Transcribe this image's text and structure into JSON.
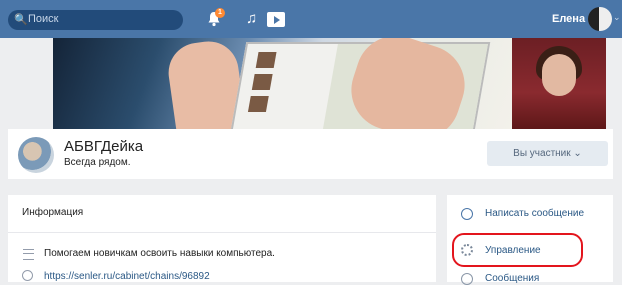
{
  "topbar": {
    "search_placeholder": "Поиск",
    "notifications_count": "1",
    "user_name": "Елена"
  },
  "group": {
    "name": "АБВГДейка",
    "status": "Всегда рядом.",
    "member_button": "Вы участник ⌄"
  },
  "info": {
    "title": "Информация",
    "description": "Помогаем новичкам освоить навыки компьютера.",
    "link": "https://senler.ru/cabinet/chains/96892"
  },
  "sidebar": {
    "items": [
      {
        "label": "Написать сообщение"
      },
      {
        "label": "Управление"
      },
      {
        "label": "Сообщения"
      }
    ]
  },
  "colors": {
    "topbar": "#4a76a8",
    "link": "#2a5885",
    "highlight": "#e3151d"
  }
}
